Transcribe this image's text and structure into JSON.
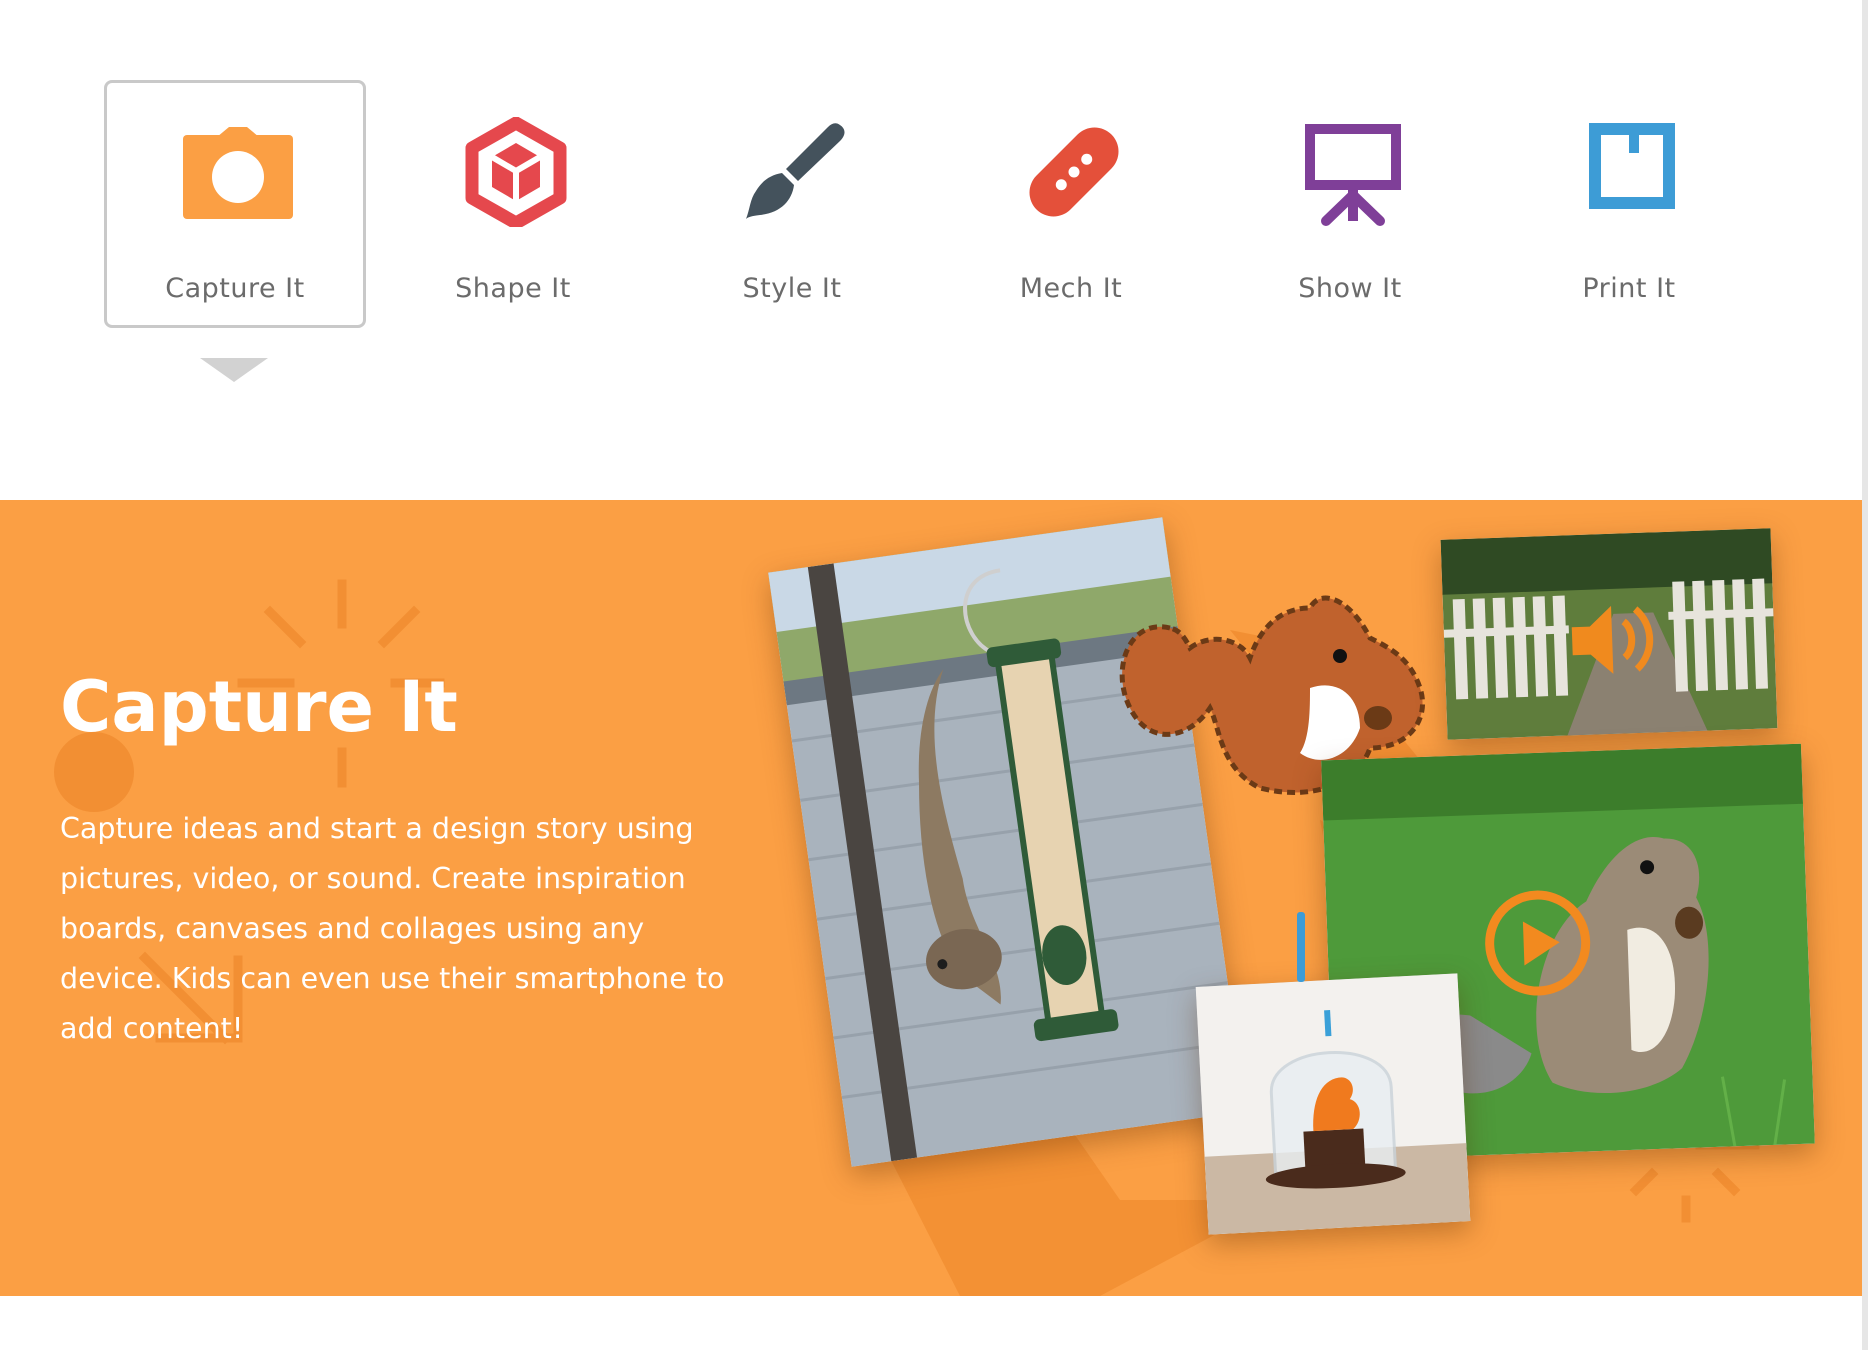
{
  "tabs": [
    {
      "label": "Capture It",
      "icon": "camera-icon",
      "color": "#fb9f44",
      "active": true
    },
    {
      "label": "Shape It",
      "icon": "cube-icon",
      "color": "#e5484d",
      "active": false
    },
    {
      "label": "Style It",
      "icon": "paintbrush-icon",
      "color": "#44525c",
      "active": false
    },
    {
      "label": "Mech It",
      "icon": "bandage-icon",
      "color": "#e4503a",
      "active": false
    },
    {
      "label": "Show It",
      "icon": "presentation-board-icon",
      "color": "#7f3f98",
      "active": false
    },
    {
      "label": "Print It",
      "icon": "print-page-icon",
      "color": "#3d9cd6",
      "active": false
    }
  ],
  "panel": {
    "title": "Capture It",
    "description": "Capture ideas and start a design story using pictures, video, or sound. Create inspiration boards, canvases and collages using any device. Kids can even use their smartphone to add content!",
    "background_color": "#fb9f44",
    "images": [
      {
        "name": "squirrel-on-bird-feeder-photo"
      },
      {
        "name": "felt-squirrel-cutout-image"
      },
      {
        "name": "garden-gate-audio-photo",
        "overlay_icon": "speaker-icon"
      },
      {
        "name": "squirrel-eating-acorn-video",
        "overlay_icon": "play-icon"
      },
      {
        "name": "squirrel-dome-model-photo"
      }
    ]
  }
}
